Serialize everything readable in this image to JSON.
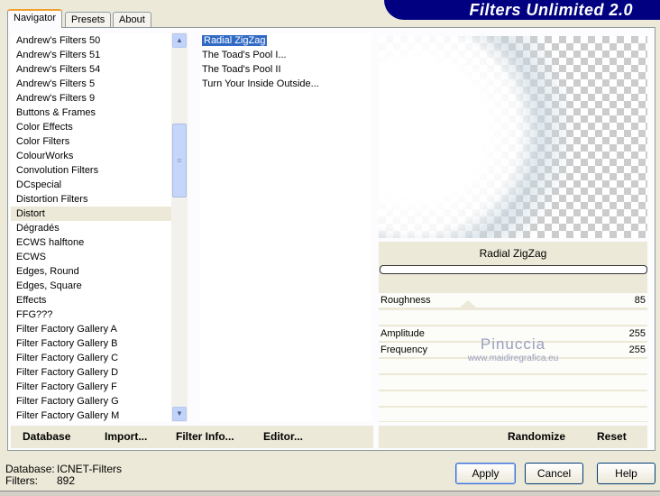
{
  "banner": {
    "title": "Filters Unlimited 2.0"
  },
  "tabs": [
    {
      "label": "Navigator"
    },
    {
      "label": "Presets"
    },
    {
      "label": "About"
    }
  ],
  "categories": [
    "Andrew's Filters 50",
    "Andrew's Filters 51",
    "Andrew's Filters 54",
    "Andrew's Filters 5",
    "Andrew's Filters 9",
    "Buttons & Frames",
    "Color Effects",
    "Color Filters",
    "ColourWorks",
    "Convolution Filters",
    "DCspecial",
    "Distortion Filters",
    "Distort",
    "Dégradés",
    "ECWS halftone",
    "ECWS",
    "Edges, Round",
    "Edges, Square",
    "Effects",
    "FFG???",
    "Filter Factory Gallery A",
    "Filter Factory Gallery B",
    "Filter Factory Gallery C",
    "Filter Factory Gallery D",
    "Filter Factory Gallery F",
    "Filter Factory Gallery G",
    "Filter Factory Gallery M"
  ],
  "selected_category": "Distort",
  "filters": [
    "Radial ZigZag",
    "The Toad's Pool I...",
    "The Toad's Pool II",
    "Turn Your Inside Outside..."
  ],
  "selected_filter": "Radial ZigZag",
  "filter_name": "Radial ZigZag",
  "params": [
    {
      "label": "Roughness",
      "value": "85"
    },
    {
      "label": "Amplitude",
      "value": "255"
    },
    {
      "label": "Frequency",
      "value": "255"
    }
  ],
  "watermark": {
    "name": "Pinuccia",
    "url": "www.maidiregrafica.eu"
  },
  "bottom_buttons": {
    "database": "Database",
    "import": "Import...",
    "filter_info": "Filter Info...",
    "editor": "Editor...",
    "randomize": "Randomize",
    "reset": "Reset"
  },
  "status": {
    "database_label": "Database:",
    "database_value": "ICNET-Filters",
    "filters_label": "Filters:",
    "filters_value": "892"
  },
  "dialog_buttons": {
    "apply": "Apply",
    "cancel": "Cancel",
    "help": "Help"
  }
}
